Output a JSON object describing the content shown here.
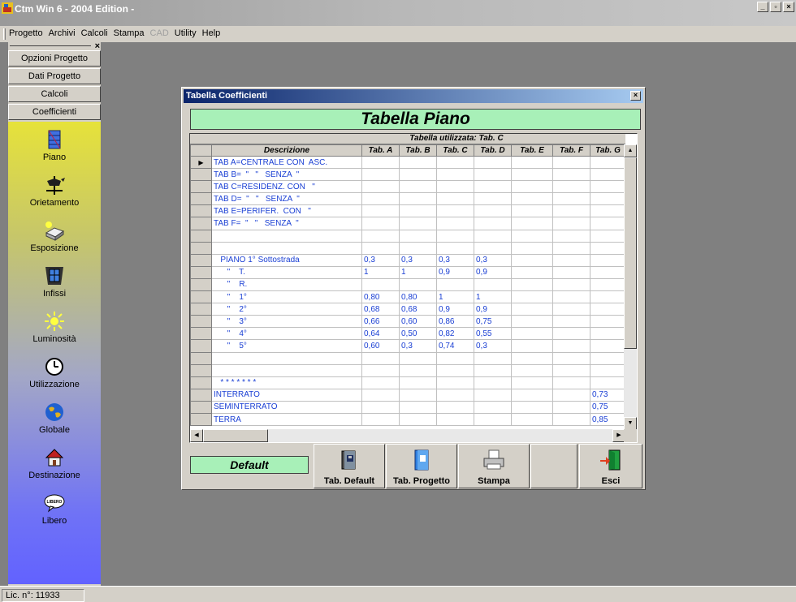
{
  "app": {
    "title": "Ctm Win 6 - 2004 Edition -"
  },
  "window_buttons": [
    "_",
    "▫",
    "×"
  ],
  "menu": [
    {
      "label": "Progetto",
      "enabled": true
    },
    {
      "label": "Archivi",
      "enabled": true
    },
    {
      "label": "Calcoli",
      "enabled": true
    },
    {
      "label": "Stampa",
      "enabled": true
    },
    {
      "label": "CAD",
      "enabled": false
    },
    {
      "label": "Utility",
      "enabled": true
    },
    {
      "label": "Help",
      "enabled": true
    }
  ],
  "sidebar": {
    "close_glyph": "×",
    "nav": [
      "Opzioni Progetto",
      "Dati Progetto",
      "Calcoli",
      "Coefficienti"
    ],
    "tools": [
      {
        "label": "Piano",
        "icon": "building-floors-icon"
      },
      {
        "label": "Orietamento",
        "icon": "weathervane-icon"
      },
      {
        "label": "Esposizione",
        "icon": "sun-block-icon"
      },
      {
        "label": "Infissi",
        "icon": "window-icon"
      },
      {
        "label": "Luminosità",
        "icon": "sun-icon"
      },
      {
        "label": "Utilizzazione",
        "icon": "clock-icon"
      },
      {
        "label": "Globale",
        "icon": "globe-icon"
      },
      {
        "label": "Destinazione",
        "icon": "house-icon"
      },
      {
        "label": "Libero",
        "icon": "libero-speech-icon"
      }
    ]
  },
  "status": {
    "license": "Lic. n°: 11933"
  },
  "dialog": {
    "title": "Tabella Coefficienti",
    "close_glyph": "×",
    "banner": "Tabella Piano",
    "grid_caption": "Tabella utilizzata: Tab. C",
    "columns": [
      "Descrizione",
      "Tab. A",
      "Tab. B",
      "Tab. C",
      "Tab. D",
      "Tab. E",
      "Tab. F",
      "Tab. G"
    ],
    "rows": [
      [
        "TAB A=CENTRALE CON  ASC.",
        "",
        "",
        "",
        "",
        "",
        "",
        ""
      ],
      [
        "TAB B=  \"   \"   SENZA  \"",
        "",
        "",
        "",
        "",
        "",
        "",
        ""
      ],
      [
        "TAB C=RESIDENZ. CON   \"",
        "",
        "",
        "",
        "",
        "",
        "",
        ""
      ],
      [
        "TAB D=  \"   \"   SENZA  \"",
        "",
        "",
        "",
        "",
        "",
        "",
        ""
      ],
      [
        "TAB E=PERIFER.  CON   \"",
        "",
        "",
        "",
        "",
        "",
        "",
        ""
      ],
      [
        "TAB F=  \"   \"   SENZA  \"",
        "",
        "",
        "",
        "",
        "",
        "",
        ""
      ],
      [
        "",
        "",
        "",
        "",
        "",
        "",
        "",
        ""
      ],
      [
        "",
        "",
        "",
        "",
        "",
        "",
        "",
        ""
      ],
      [
        "   PIANO 1° Sottostrada",
        "0,3",
        "0,3",
        "0,3",
        "0,3",
        "",
        "",
        ""
      ],
      [
        "      \"    T.",
        "1",
        "1",
        "0,9",
        "0,9",
        "",
        "",
        ""
      ],
      [
        "      \"    R.",
        "",
        "",
        "",
        "",
        "",
        "",
        ""
      ],
      [
        "      \"    1°",
        "0,80",
        "0,80",
        "1",
        "1",
        "",
        "",
        ""
      ],
      [
        "      \"    2°",
        "0,68",
        "0,68",
        "0,9",
        "0,9",
        "",
        "",
        ""
      ],
      [
        "      \"    3°",
        "0,66",
        "0,60",
        "0,86",
        "0,75",
        "",
        "",
        ""
      ],
      [
        "      \"    4°",
        "0,64",
        "0,50",
        "0,82",
        "0,55",
        "",
        "",
        ""
      ],
      [
        "      \"    5°",
        "0,60",
        "0,3",
        "0,74",
        "0,3",
        "",
        "",
        ""
      ],
      [
        "",
        "",
        "",
        "",
        "",
        "",
        "",
        ""
      ],
      [
        "",
        "",
        "",
        "",
        "",
        "",
        "",
        ""
      ],
      [
        "   * * * * * * *",
        "",
        "",
        "",
        "",
        "",
        "",
        ""
      ],
      [
        "INTERRATO",
        "",
        "",
        "",
        "",
        "",
        "",
        "0,73"
      ],
      [
        "SEMINTERRATO",
        "",
        "",
        "",
        "",
        "",
        "",
        "0,75"
      ],
      [
        "TERRA",
        "",
        "",
        "",
        "",
        "",
        "",
        "0,85"
      ]
    ],
    "current_row_marker": "▶",
    "default_label": "Default",
    "buttons": [
      {
        "label": "Tab. Default",
        "icon": "book-disk-icon"
      },
      {
        "label": "Tab. Progetto",
        "icon": "book-blue-icon"
      },
      {
        "label": "Stampa",
        "icon": "printer-icon"
      },
      {
        "label": "Esci",
        "icon": "exit-door-icon"
      }
    ],
    "scroll_glyphs": {
      "up": "▲",
      "down": "▼",
      "left": "◀",
      "right": "▶"
    }
  },
  "colors": {
    "banner_bg": "#a8f0b8",
    "cell_text": "#1a3fd4",
    "titlebar_start": "#0a246a"
  }
}
